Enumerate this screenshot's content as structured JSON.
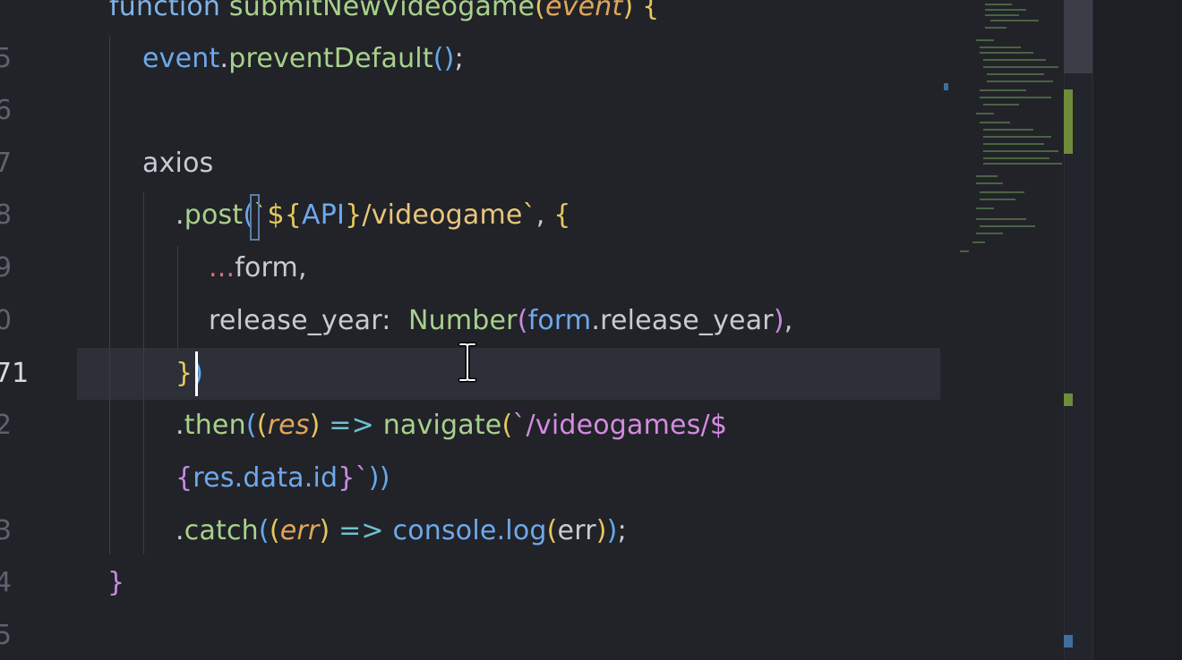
{
  "editor": {
    "line_numbers": [
      "5",
      "6",
      "7",
      "8",
      "9",
      "0",
      "71",
      "2",
      "3",
      "4",
      "5"
    ],
    "active_line": "71",
    "code": {
      "l4_keyword": "function",
      "l4_name": "submitNewVideogame",
      "l4_open": "(",
      "l4_param": "event",
      "l4_close": ")",
      "l4_brace": " {",
      "l5_obj": "event",
      "l5_dot": ".",
      "l5_method": "preventDefault",
      "l5_parens": "()",
      "l5_semi": ";",
      "l7_axios": "axios",
      "l8_dot": ".",
      "l8_post": "post",
      "l8_open": "(",
      "l8_str1": "`",
      "l8_interp_open": "${",
      "l8_api": "API",
      "l8_interp_close": "}",
      "l8_str2": "/videogame`",
      "l8_comma": ", ",
      "l8_brace": "{",
      "l9_spread": "...",
      "l9_form": "form,",
      "l10_key": "release_year:  ",
      "l10_number": "Number",
      "l10_open": "(",
      "l10_form": "form",
      "l10_prop": ".release_year",
      "l10_close": ")",
      "l10_comma": ",",
      "l11_brace": "}",
      "l11_paren": ")",
      "l12_dot": ".",
      "l12_then": "then",
      "l12_open": "(",
      "l12_popen": "(",
      "l12_res": "res",
      "l12_pclose": ")",
      "l12_arrow": " => ",
      "l12_nav": "navigate",
      "l12_nopen": "(",
      "l12_str": "`/videogames/$",
      "l12b_open": "{",
      "l12b_expr": "res.data.id",
      "l12b_close": "}",
      "l12b_tick": "`",
      "l12b_end": "))",
      "l13_dot": ".",
      "l13_catch": "catch",
      "l13_open": "(",
      "l13_popen": "(",
      "l13_err": "err",
      "l13_pclose": ")",
      "l13_arrow": " => ",
      "l13_console": "console",
      "l13_log": ".log",
      "l13_lopen": "(",
      "l13_arg": "err",
      "l13_lclose": ")",
      "l13_close": ")",
      "l13_semi": ";",
      "l14_brace": "}"
    }
  },
  "colors": {
    "background": "#212329",
    "current_line": "#2d3039",
    "keyword": "#7fb3e6",
    "function": "#a8d18b",
    "string": "#e8c67a",
    "parameter": "#e0a55a"
  }
}
